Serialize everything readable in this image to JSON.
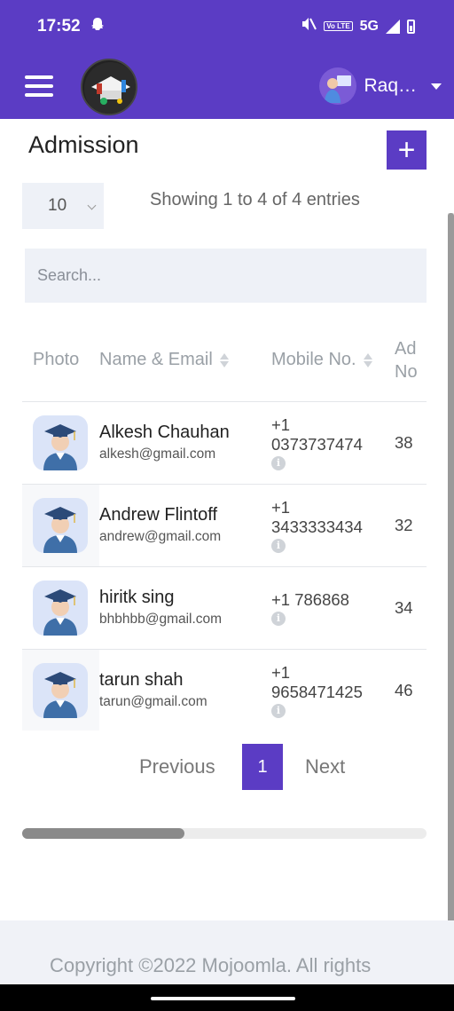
{
  "status_bar": {
    "time": "17:52",
    "network": "5G",
    "volte": "Vo LTE",
    "icons": [
      "snapchat-icon",
      "mute-icon",
      "volte-icon",
      "signal-icon",
      "battery-icon"
    ]
  },
  "app_bar": {
    "menu_icon": "hamburger-menu-icon",
    "logo": "school-logo",
    "user_name": "Raq…"
  },
  "page": {
    "title": "Admission",
    "add_label": "+"
  },
  "controls": {
    "page_length": "10",
    "info": "Showing 1 to 4 of 4 entries",
    "search_placeholder": "Search..."
  },
  "table": {
    "headers": {
      "photo": "Photo",
      "name_email": "Name & Email",
      "mobile": "Mobile No.",
      "admission_line1": "Ad",
      "admission_line2": "No"
    },
    "rows": [
      {
        "name": "Alkesh Chauhan",
        "email": "alkesh@gmail.com",
        "mobile_code": "+1",
        "mobile_number": "0373737474",
        "admission": "38"
      },
      {
        "name": "Andrew Flintoff",
        "email": "andrew@gmail.com",
        "mobile_code": "+1",
        "mobile_number": "3433333434",
        "admission": "32"
      },
      {
        "name": "hiritk sing",
        "email": "bhbhbb@gmail.com",
        "mobile_code": "+1",
        "mobile_number": "786868",
        "admission": "34"
      },
      {
        "name": "tarun shah",
        "email": "tarun@gmail.com",
        "mobile_code": "+1",
        "mobile_number": "9658471425",
        "admission": "46"
      }
    ]
  },
  "pagination": {
    "previous": "Previous",
    "current": "1",
    "next": "Next"
  },
  "footer": {
    "text": "Copyright ©2022 Mojoomla. All rights"
  },
  "colors": {
    "primary": "#5b3cc4",
    "input_bg": "#eef1f7",
    "header_text": "#9aa0a6"
  }
}
